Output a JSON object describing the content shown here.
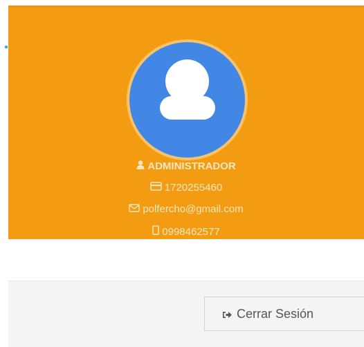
{
  "profile": {
    "avatar_icon": "user-avatar-icon",
    "role": "ADMINISTRADOR",
    "id_number": "1720255460",
    "email": "polfercho@gmail.com",
    "phone": "0998462577",
    "role_icon": "user-icon",
    "id_icon": "credit-card-icon",
    "email_icon": "envelope-icon",
    "phone_icon": "mobile-icon"
  },
  "footer": {
    "logout_label": "Cerrar Sesión",
    "logout_icon": "sign-out-icon"
  },
  "colors": {
    "panel": "#f39c12",
    "avatar": "#4286e6",
    "text": "#fbe6bf",
    "footer": "#f4f4f4"
  }
}
